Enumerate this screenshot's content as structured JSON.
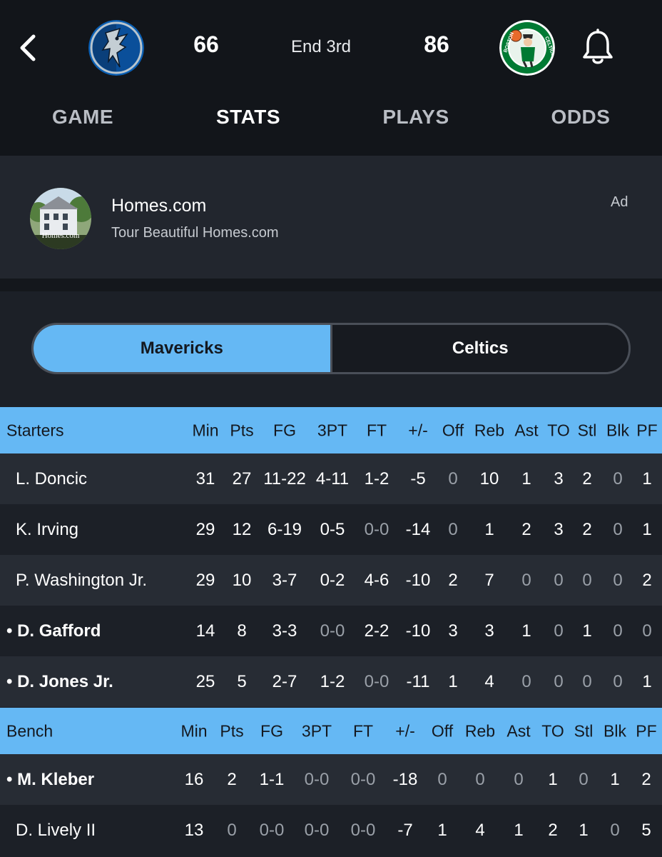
{
  "header": {
    "back_label": "Back",
    "away_score": "66",
    "home_score": "86",
    "period": "End 3rd",
    "away_logo": "mavericks-logo",
    "home_logo": "celtics-logo"
  },
  "tabs": [
    {
      "label": "GAME",
      "active": false
    },
    {
      "label": "STATS",
      "active": true
    },
    {
      "label": "PLAYS",
      "active": false
    },
    {
      "label": "ODDS",
      "active": false
    }
  ],
  "ad": {
    "title": "Homes.com",
    "subtitle": "Tour Beautiful Homes.com",
    "tag": "Ad",
    "thumb_caption": "Homes.com"
  },
  "team_toggle": {
    "left": "Mavericks",
    "right": "Celtics",
    "selected": "Mavericks"
  },
  "starters": {
    "title": "Starters",
    "columns": [
      "Min",
      "Pts",
      "FG",
      "3PT",
      "FT",
      "+/-",
      "Off",
      "Reb",
      "Ast",
      "TO",
      "Stl",
      "Blk",
      "PF"
    ],
    "rows": [
      {
        "name": "L. Doncic",
        "on_court": false,
        "stats": [
          "31",
          "27",
          "11-22",
          "4-11",
          "1-2",
          "-5",
          "0",
          "10",
          "1",
          "3",
          "2",
          "0",
          "1"
        ]
      },
      {
        "name": "K. Irving",
        "on_court": false,
        "stats": [
          "29",
          "12",
          "6-19",
          "0-5",
          "0-0",
          "-14",
          "0",
          "1",
          "2",
          "3",
          "2",
          "0",
          "1"
        ]
      },
      {
        "name": "P. Washington Jr.",
        "on_court": false,
        "stats": [
          "29",
          "10",
          "3-7",
          "0-2",
          "4-6",
          "-10",
          "2",
          "7",
          "0",
          "0",
          "0",
          "0",
          "2"
        ]
      },
      {
        "name": "• D. Gafford",
        "on_court": true,
        "stats": [
          "14",
          "8",
          "3-3",
          "0-0",
          "2-2",
          "-10",
          "3",
          "3",
          "1",
          "0",
          "1",
          "0",
          "0"
        ]
      },
      {
        "name": "• D. Jones Jr.",
        "on_court": true,
        "stats": [
          "25",
          "5",
          "2-7",
          "1-2",
          "0-0",
          "-11",
          "1",
          "4",
          "0",
          "0",
          "0",
          "0",
          "1"
        ]
      }
    ]
  },
  "bench": {
    "title": "Bench",
    "columns": [
      "Min",
      "Pts",
      "FG",
      "3PT",
      "FT",
      "+/-",
      "Off",
      "Reb",
      "Ast",
      "TO",
      "Stl",
      "Blk",
      "PF"
    ],
    "rows": [
      {
        "name": "• M. Kleber",
        "on_court": true,
        "stats": [
          "16",
          "2",
          "1-1",
          "0-0",
          "0-0",
          "-18",
          "0",
          "0",
          "0",
          "1",
          "0",
          "1",
          "2"
        ]
      },
      {
        "name": "D. Lively II",
        "on_court": false,
        "stats": [
          "13",
          "0",
          "0-0",
          "0-0",
          "0-0",
          "-7",
          "1",
          "4",
          "1",
          "2",
          "1",
          "0",
          "5"
        ]
      }
    ]
  },
  "colors": {
    "accent": "#65b8f4",
    "row_alt": "#272c34",
    "background": "#1c2027",
    "header_bg": "#12151a"
  }
}
